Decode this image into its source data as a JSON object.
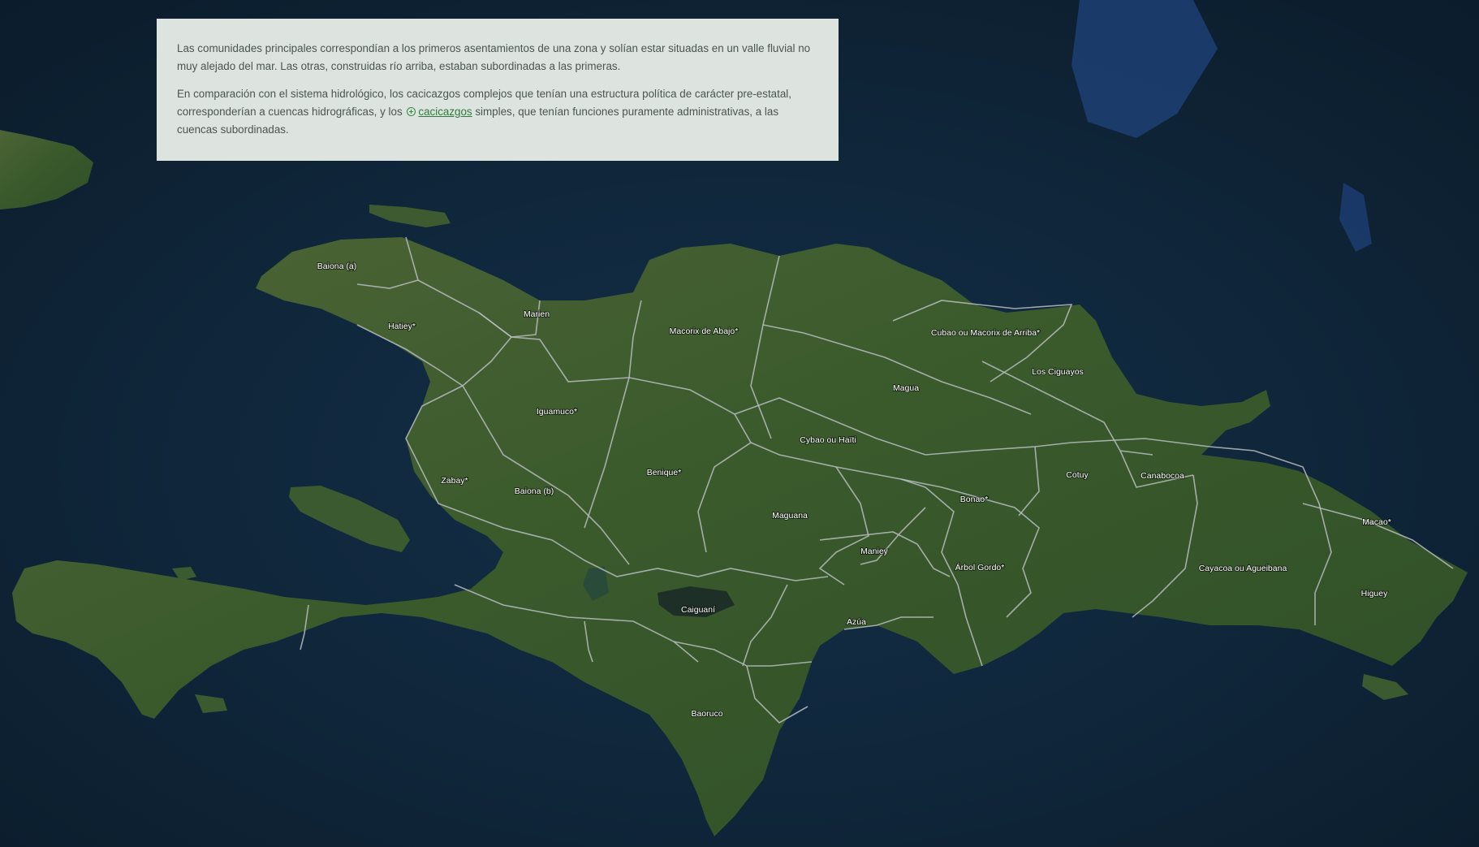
{
  "info": {
    "paragraph1": "Las comunidades principales correspondían a los primeros asentamientos de una zona y solían estar situadas en un valle fluvial no muy alejado del mar. Las otras, construidas río arriba, estaban subordinadas a las primeras.",
    "paragraph2_before": "En comparación con el sistema hidrológico, los cacicazgos complejos que tenían una estructura política de carácter pre-estatal, corresponderían a cuencas hidrográficas, y los",
    "paragraph2_link": "cacicazgos",
    "paragraph2_after": "simples, que tenían funciones puramente administrativas, a las cuencas subordinadas.",
    "link_icon": "plus-circle-icon"
  },
  "map": {
    "colors": {
      "ocean": "#10263a",
      "land": "#3f5a30",
      "border": "#b8bcc0",
      "card": "#dde3df",
      "link": "#2f7a3c"
    },
    "regions": [
      "Baiona (a)",
      "Hatiey*",
      "Marien",
      "Macorix de Abajo*",
      "Cubao ou Macorix de Arriba*",
      "Los Ciguayos",
      "Magua",
      "Iguamuco*",
      "Cybao ou Haïti",
      "Benique*",
      "Zabay*",
      "Baiona (b)",
      "Maguana",
      "Cotuy",
      "Canabocoa",
      "Bonao*",
      "Macao*",
      "Maniey",
      "Árbol Gordo*",
      "Cayacoa ou Agueibana",
      "Higuey",
      "Caiguaní",
      "Azúa",
      "Baoruco"
    ]
  }
}
